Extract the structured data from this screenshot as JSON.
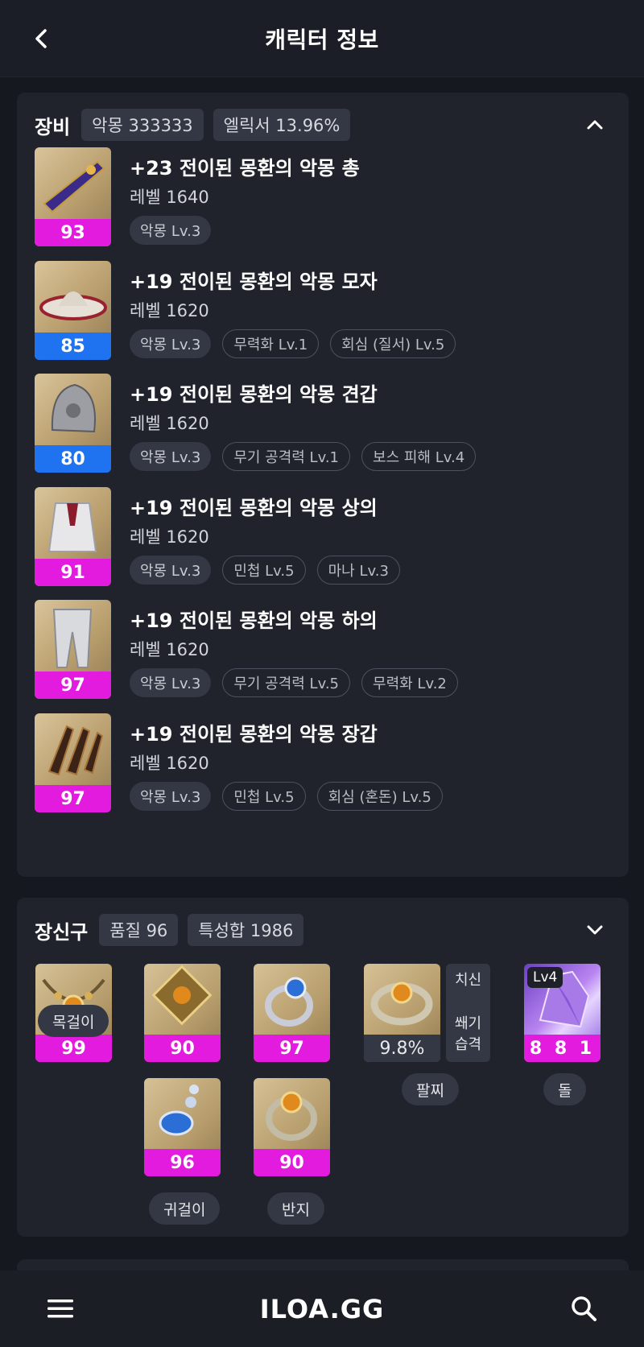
{
  "header": {
    "title": "캐릭터 정보"
  },
  "equipment": {
    "title": "장비",
    "badges": [
      "악몽 333333",
      "엘릭서 13.96%"
    ],
    "items": [
      {
        "name": "+23 전이된 몽환의 악몽 총",
        "level": "레벨 1640",
        "quality": "93",
        "quality_color": "#e31bde",
        "tags": [
          {
            "text": "악몽 Lv.3",
            "style": "fill"
          }
        ]
      },
      {
        "name": "+19 전이된 몽환의 악몽 모자",
        "level": "레벨 1620",
        "quality": "85",
        "quality_color": "#1f73f0",
        "tags": [
          {
            "text": "악몽 Lv.3",
            "style": "fill"
          },
          {
            "text": "무력화 Lv.1",
            "style": "outline"
          },
          {
            "text": "회심 (질서) Lv.5",
            "style": "outline"
          }
        ]
      },
      {
        "name": "+19 전이된 몽환의 악몽 견갑",
        "level": "레벨 1620",
        "quality": "80",
        "quality_color": "#1f73f0",
        "tags": [
          {
            "text": "악몽 Lv.3",
            "style": "fill"
          },
          {
            "text": "무기 공격력 Lv.1",
            "style": "outline"
          },
          {
            "text": "보스 피해 Lv.4",
            "style": "outline"
          }
        ]
      },
      {
        "name": "+19 전이된 몽환의 악몽 상의",
        "level": "레벨 1620",
        "quality": "91",
        "quality_color": "#e31bde",
        "tags": [
          {
            "text": "악몽 Lv.3",
            "style": "fill"
          },
          {
            "text": "민첩 Lv.5",
            "style": "outline"
          },
          {
            "text": "마나 Lv.3",
            "style": "outline"
          }
        ]
      },
      {
        "name": "+19 전이된 몽환의 악몽 하의",
        "level": "레벨 1620",
        "quality": "97",
        "quality_color": "#e31bde",
        "tags": [
          {
            "text": "악몽 Lv.3",
            "style": "fill"
          },
          {
            "text": "무기 공격력 Lv.5",
            "style": "outline"
          },
          {
            "text": "무력화 Lv.2",
            "style": "outline"
          }
        ]
      },
      {
        "name": "+19 전이된 몽환의 악몽 장갑",
        "level": "레벨 1620",
        "quality": "97",
        "quality_color": "#e31bde",
        "tags": [
          {
            "text": "악몽 Lv.3",
            "style": "fill"
          },
          {
            "text": "민첩 Lv.5",
            "style": "outline"
          },
          {
            "text": "회심 (혼돈) Lv.5",
            "style": "outline"
          }
        ]
      }
    ]
  },
  "accessories": {
    "title": "장신구",
    "badges": [
      "품질 96",
      "특성합 1986"
    ],
    "necklace": {
      "quality": "99",
      "label": "목걸이"
    },
    "earrings": {
      "quality": [
        "90",
        "96"
      ],
      "label": "귀걸이"
    },
    "rings": {
      "quality": [
        "97",
        "90"
      ],
      "label": "반지"
    },
    "bracelet": {
      "value": "9.8%",
      "stats": [
        "치신",
        "쐐기",
        "습격"
      ],
      "label": "팔찌"
    },
    "stone": {
      "level": "Lv4",
      "quality": "8 8 1",
      "label": "돌"
    }
  },
  "bottom": {
    "logo": "ILOA.GG"
  },
  "colors": {
    "quality_magenta": "#e31bde",
    "quality_blue": "#1f73f0",
    "background": "#16181f",
    "card": "#20232c"
  }
}
